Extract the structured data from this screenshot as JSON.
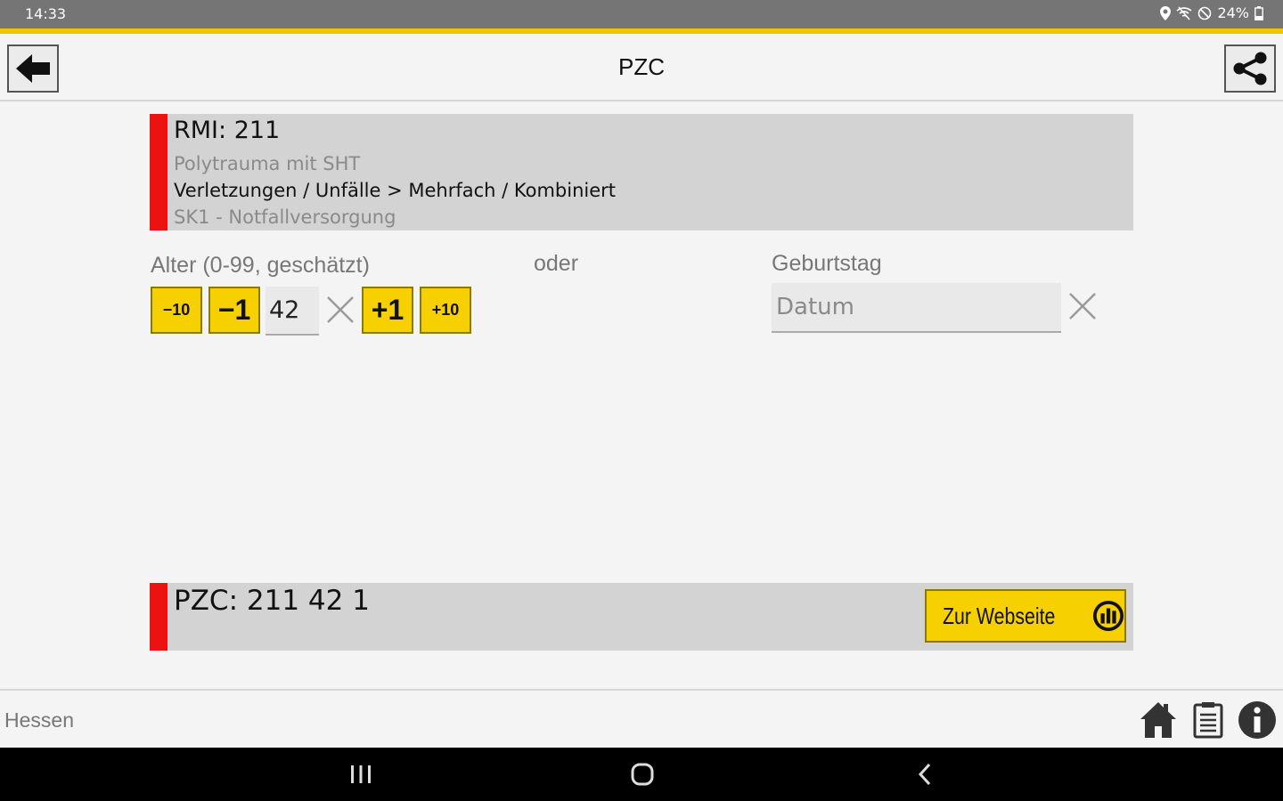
{
  "status": {
    "time": "14:33",
    "battery": "24%"
  },
  "header": {
    "title": "PZC"
  },
  "info": {
    "rmi": "RMI: 211",
    "diagnosis": "Polytrauma mit SHT",
    "category": "Verletzungen / Unfälle > Mehrfach / Kombiniert",
    "care_level": "SK1 - Notfallversorgung"
  },
  "age": {
    "label": "Alter (0-99, geschätzt)",
    "value": "42",
    "minus10": "−10",
    "minus1": "−1",
    "plus1": "+1",
    "plus10": "+10"
  },
  "or_label": "oder",
  "birthday": {
    "label": "Geburtstag",
    "placeholder": "Datum"
  },
  "pzc": {
    "code": "PZC: 211 42 1",
    "website_button": "Zur Webseite"
  },
  "footer": {
    "region": "Hessen"
  },
  "colors": {
    "accent_yellow": "#f6d000",
    "marker_red": "#ee1111",
    "card_gray": "#d3d3d3"
  },
  "icons": [
    "back-arrow-icon",
    "share-icon",
    "close-icon",
    "chart-icon",
    "home-icon",
    "document-icon",
    "info-icon",
    "location-icon",
    "battery-icon"
  ]
}
